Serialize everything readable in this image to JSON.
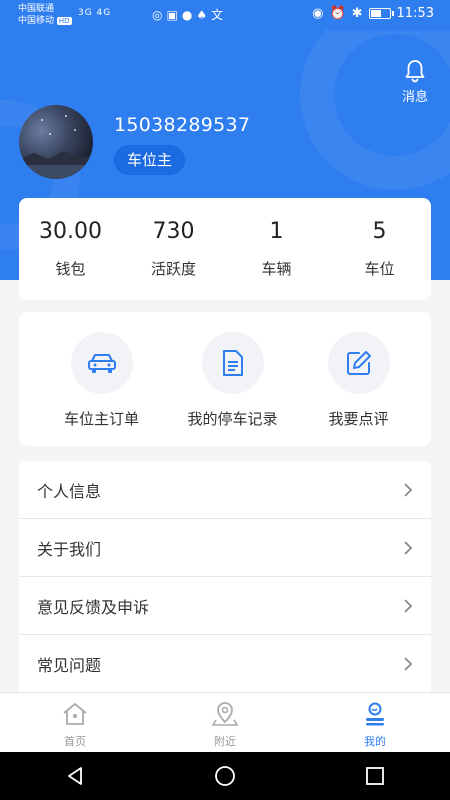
{
  "status_bar": {
    "carrier1": "中国联通",
    "carrier2": "中国移动",
    "hd": "HD",
    "network": "3G 4G",
    "time": "11:53",
    "battery_level": 0.6
  },
  "header": {
    "message_label": "消息",
    "phone": "15038289537",
    "role_badge": "车位主"
  },
  "stats": [
    {
      "value": "30.00",
      "label": "钱包"
    },
    {
      "value": "730",
      "label": "活跃度"
    },
    {
      "value": "1",
      "label": "车辆"
    },
    {
      "value": "5",
      "label": "车位"
    }
  ],
  "actions": [
    {
      "label": "车位主订单",
      "icon": "car-icon"
    },
    {
      "label": "我的停车记录",
      "icon": "document-icon"
    },
    {
      "label": "我要点评",
      "icon": "edit-icon"
    }
  ],
  "menu": [
    {
      "label": "个人信息"
    },
    {
      "label": "关于我们"
    },
    {
      "label": "意见反馈及申诉"
    },
    {
      "label": "常见问题"
    }
  ],
  "tabs": [
    {
      "label": "首页",
      "icon": "home-icon",
      "active": false
    },
    {
      "label": "附近",
      "icon": "location-pin-icon",
      "active": false
    },
    {
      "label": "我的",
      "icon": "profile-icon",
      "active": true
    }
  ],
  "colors": {
    "primary": "#2f7ef0",
    "badge": "#1c6ae0",
    "background": "#f4f5f7"
  }
}
